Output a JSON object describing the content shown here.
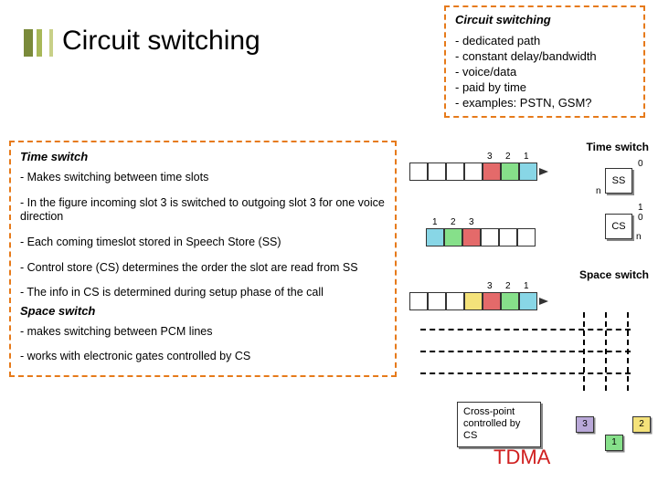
{
  "title": "Circuit switching",
  "callout_right": {
    "title": "Circuit switching",
    "items": [
      "- dedicated path",
      "- constant delay/bandwidth",
      "- voice/data",
      "- paid by time",
      "- examples: PSTN, GSM?"
    ]
  },
  "left": {
    "section1_title": "Time switch",
    "section1_items": [
      "- Makes switching between time slots",
      "- In the figure incoming slot 3 is switched to outgoing slot 3 for one voice direction",
      "- Each coming timeslot stored in Speech Store (SS)",
      "- Control store (CS) determines the order the slot are read from SS",
      "- The info in CS is determined during setup phase of the call"
    ],
    "section2_title": "Space switch",
    "section2_items": [
      "-  makes switching between PCM lines",
      "- works with electronic gates controlled by CS"
    ]
  },
  "diagram": {
    "label_time": "Time switch",
    "label_space": "Space switch",
    "ss": "SS",
    "cs": "CS",
    "n": "n",
    "zero": "0",
    "one": "1",
    "d1": "1",
    "d2": "2",
    "d3": "3",
    "crosspoint": "Cross-point controlled by CS",
    "tdma": "TDMA",
    "chip1": "3",
    "chip2": "1",
    "chip3": "2"
  }
}
